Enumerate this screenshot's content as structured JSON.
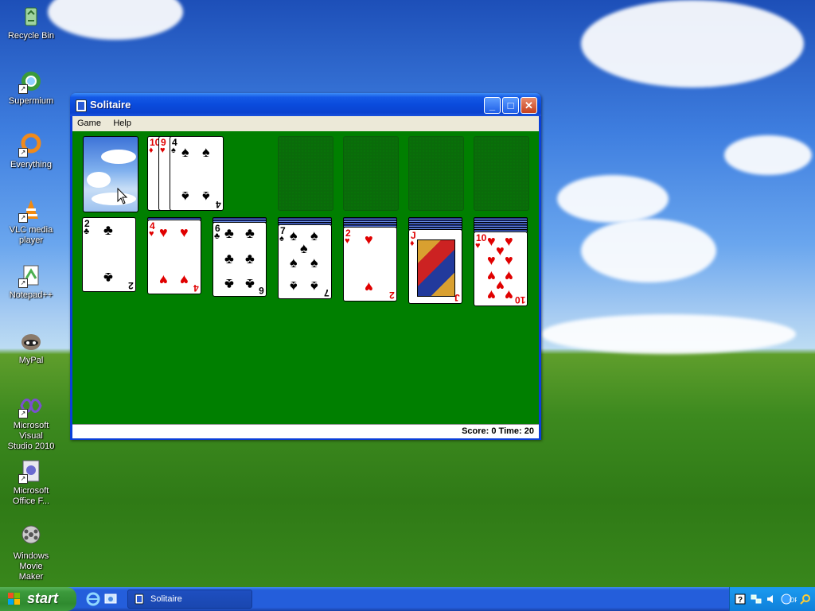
{
  "desktop": {
    "icons": [
      {
        "label_line1": "Recycle Bin",
        "label_line2": "",
        "icon": "recycle-bin-icon"
      },
      {
        "label_line1": "Supermium",
        "label_line2": "",
        "icon": "supermium-icon"
      },
      {
        "label_line1": "Everything",
        "label_line2": "",
        "icon": "everything-search-icon"
      },
      {
        "label_line1": "VLC media",
        "label_line2": "player",
        "icon": "vlc-cone-icon"
      },
      {
        "label_line1": "Notepad++",
        "label_line2": "",
        "icon": "notepadpp-icon"
      },
      {
        "label_line1": "MyPal",
        "label_line2": "",
        "icon": "mypal-raccoon-icon"
      },
      {
        "label_line1": "Microsoft Visual",
        "label_line2": "Studio 2010",
        "icon": "visual-studio-icon"
      },
      {
        "label_line1": "Microsoft",
        "label_line2": "Office F...",
        "icon": "office-icon"
      },
      {
        "label_line1": "Windows Movie",
        "label_line2": "Maker",
        "icon": "movie-maker-icon"
      }
    ]
  },
  "window": {
    "title": "Solitaire",
    "controls": {
      "minimize": "_",
      "maximize": "□",
      "close": "✕"
    },
    "menu": [
      "Game",
      "Help"
    ],
    "status": "Score: 0 Time: 20"
  },
  "game": {
    "stock": {
      "back": "sky-clouds"
    },
    "waste": [
      {
        "rank": "10",
        "suit": "♦",
        "color": "red"
      },
      {
        "rank": "9",
        "suit": "♥",
        "color": "red"
      },
      {
        "rank": "4",
        "suit": "♠",
        "color": "black"
      }
    ],
    "foundations": 4,
    "tableau": [
      {
        "hidden": 0,
        "rank": "2",
        "suit": "♣",
        "color": "black"
      },
      {
        "hidden": 1,
        "rank": "4",
        "suit": "♥",
        "color": "red"
      },
      {
        "hidden": 2,
        "rank": "6",
        "suit": "♣",
        "color": "black"
      },
      {
        "hidden": 3,
        "rank": "7",
        "suit": "♠",
        "color": "black"
      },
      {
        "hidden": 4,
        "rank": "2",
        "suit": "♥",
        "color": "red"
      },
      {
        "hidden": 5,
        "rank": "J",
        "suit": "♦",
        "color": "red"
      },
      {
        "hidden": 6,
        "rank": "10",
        "suit": "♥",
        "color": "red"
      }
    ]
  },
  "taskbar": {
    "start_label": "start",
    "tasks": [
      {
        "label": "Solitaire"
      }
    ],
    "tray": [
      "help-icon",
      "network-icon",
      "speaker-icon",
      "language-off-icon",
      "search-icon"
    ]
  }
}
